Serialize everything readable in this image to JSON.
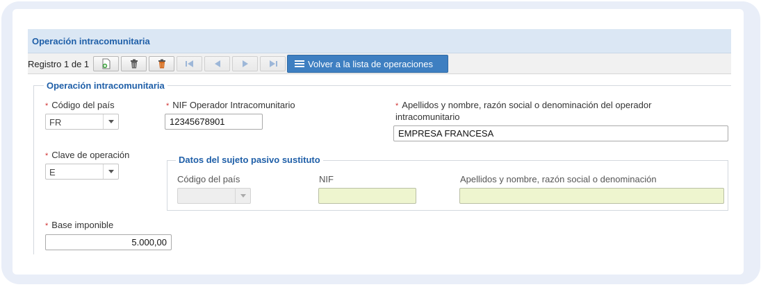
{
  "header": {
    "title": "Operación intracomunitaria"
  },
  "toolbar": {
    "record_text": "Registro 1 de 1",
    "buttons": [
      "new-record-icon",
      "delete-icon",
      "delete-all-icon",
      "first-record-icon",
      "previous-record-icon",
      "next-record-icon",
      "last-record-icon"
    ],
    "back_label": "Volver a la lista de operaciones"
  },
  "section": {
    "legend": "Operación intracomunitaria",
    "country_label": "Código del país",
    "country_value": "FR",
    "nif_label": "NIF Operador Intracomunitario",
    "nif_value": "12345678901",
    "name_label": "Apellidos y nombre, razón social o denominación del operador intracomunitario",
    "name_value": "EMPRESA FRANCESA",
    "operation_key_label": "Clave de operación",
    "operation_key_value": "E",
    "taxable_base_label": "Base imponible",
    "taxable_base_value": "5.000,00",
    "required_mark": "*"
  },
  "substitute": {
    "legend": "Datos del sujeto pasivo sustituto",
    "country_label": "Código del país",
    "country_value": "",
    "nif_label": "NIF",
    "nif_value": "",
    "name_label": "Apellidos y nombre, razón social o denominación",
    "name_value": ""
  },
  "colors": {
    "accent": "#1f5fa8",
    "button": "#3e7fc1",
    "required": "#d03030",
    "disabled_input": "#eef5cf"
  }
}
